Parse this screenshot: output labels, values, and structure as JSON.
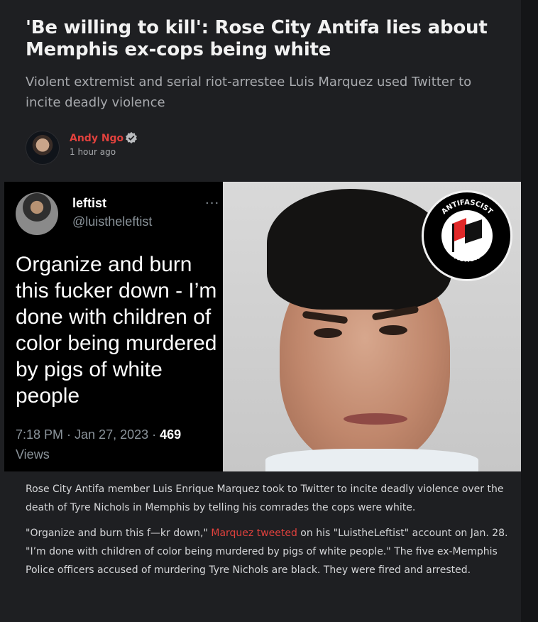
{
  "article": {
    "title": "'Be willing to kill': Rose City Antifa lies about Memphis ex-cops being white",
    "subtitle": "Violent extremist and serial riot-arrestee Luis Marquez used Twitter to incite deadly violence",
    "author": {
      "name": "Andy Ngo",
      "time": "1 hour ago",
      "verified_icon": "verified-badge-icon",
      "avatar_icon": "author-avatar"
    }
  },
  "tweet": {
    "name": "leftist",
    "handle": "@luistheleftist",
    "more": "···",
    "text": "Organize and burn this fucker down - I’m done with children of color being murdered by pigs of white people",
    "meta_date": "7:18 PM · Jan 27, 2023 · ",
    "views_count": "469",
    "views_label": "Views"
  },
  "logo": {
    "top_text": "ANTIFASCIST",
    "bottom_text": "ACTION",
    "flag_colors": [
      "#e02828",
      "#111111"
    ]
  },
  "body": {
    "p1": "Rose City Antifa member Luis Enrique Marquez took to Twitter to incite deadly violence over the death of Tyre Nichols in Memphis by telling his comrades the cops were white.",
    "p2_before": "\"Organize and burn this f—kr down,\" ",
    "p2_link": "Marquez tweeted",
    "p2_after": " on his \"LuistheLeftist\" account on Jan. 28. \"I’m done with children of color being murdered by pigs of white people.\" The five ex-Memphis Police officers accused of murdering Tyre Nichols are black. They were fired and arrested."
  },
  "colors": {
    "accent": "#e0413d",
    "background": "#1e1f22",
    "muted": "#a7a9ad"
  }
}
